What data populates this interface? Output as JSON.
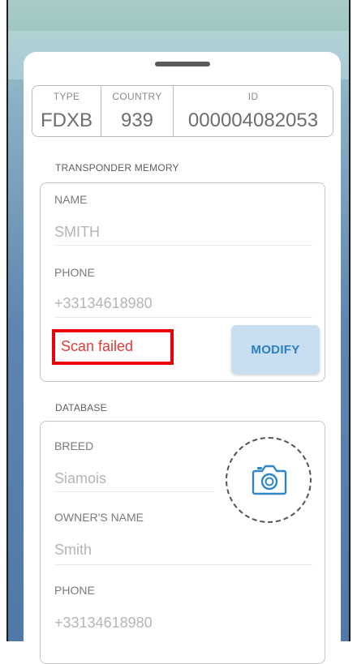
{
  "id_panel": {
    "type_label": "TYPE",
    "type_value": "FDXB",
    "country_label": "COUNTRY",
    "country_value": "939",
    "id_label": "ID",
    "id_value": "000004082053"
  },
  "transponder_memory": {
    "section_title": "TRANSPONDER MEMORY",
    "name_label": "NAME",
    "name_value": "SMITH",
    "phone_label": "PHONE",
    "phone_value": "+33134618980",
    "status_text": "Scan failed",
    "modify_label": "MODIFY"
  },
  "database": {
    "section_title": "DATABASE",
    "breed_label": "BREED",
    "breed_value": "Siamois",
    "owner_label": "OWNER'S NAME",
    "owner_value": "Smith",
    "phone_label": "PHONE",
    "phone_value": "+33134618980"
  },
  "icons": [
    "drag-handle-icon",
    "camera-icon"
  ],
  "colors": {
    "error": "#e53935",
    "accent": "#2b7ec4",
    "button_bg": "#c7dff0",
    "highlight_box": "#e8000c"
  }
}
